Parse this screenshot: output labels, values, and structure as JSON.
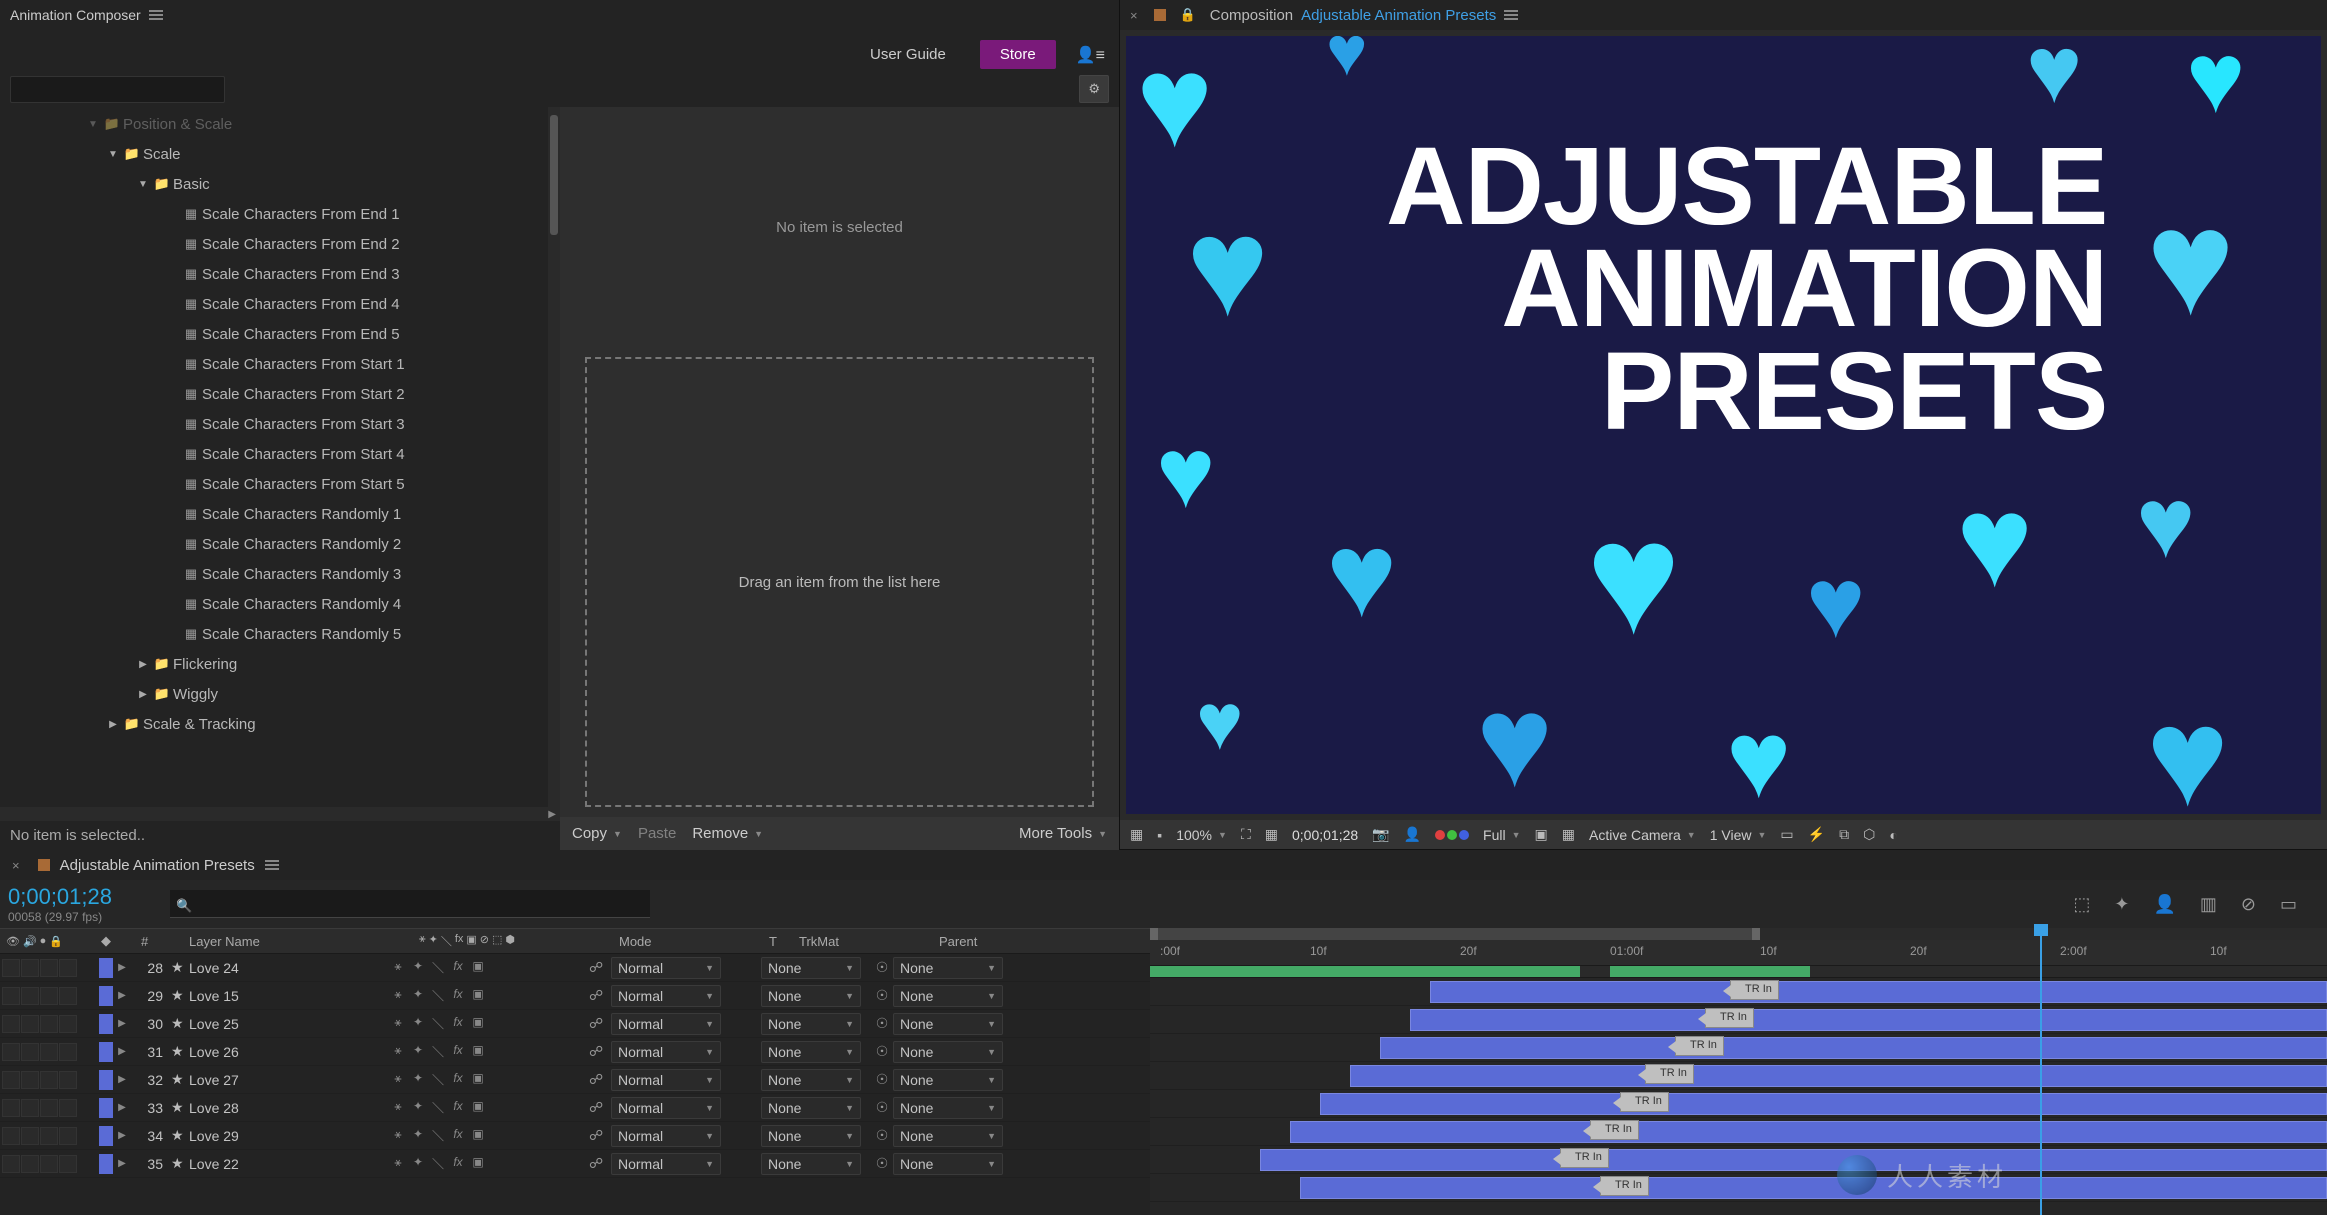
{
  "panel": {
    "title": "Animation Composer",
    "user_guide": "User Guide",
    "store": "Store",
    "settings_icon": "gear",
    "user_icon": "user"
  },
  "tree": {
    "position_scale": "Position & Scale",
    "scale": "Scale",
    "basic": "Basic",
    "items": [
      "Scale Characters From End 1",
      "Scale Characters From End 2",
      "Scale Characters From End 3",
      "Scale Characters From End 4",
      "Scale Characters From End 5",
      "Scale Characters From Start 1",
      "Scale Characters From Start 2",
      "Scale Characters From Start 3",
      "Scale Characters From Start 4",
      "Scale Characters From Start 5",
      "Scale Characters Randomly 1",
      "Scale Characters Randomly 2",
      "Scale Characters Randomly 3",
      "Scale Characters Randomly 4",
      "Scale Characters Randomly 5"
    ],
    "flickering": "Flickering",
    "wiggly": "Wiggly",
    "scale_tracking": "Scale & Tracking"
  },
  "status": "No item is selected..",
  "preview": {
    "empty": "No item is selected",
    "drag": "Drag an item from the list here",
    "copy": "Copy",
    "paste": "Paste",
    "remove": "Remove",
    "more": "More Tools"
  },
  "comp": {
    "label": "Composition",
    "name": "Adjustable Animation Presets",
    "text1": "ADJUSTABLE",
    "text2": "ANIMATION",
    "text3": "PRESETS"
  },
  "viewer_toolbar": {
    "zoom": "100%",
    "timecode": "0;00;01;28",
    "resolution": "Full",
    "camera": "Active Camera",
    "views": "1 View"
  },
  "timeline": {
    "name": "Adjustable Animation Presets",
    "timecode": "0;00;01;28",
    "frame_info": "00058 (29.97 fps)",
    "cols": {
      "num": "#",
      "name": "Layer Name",
      "mode": "Mode",
      "t": "T",
      "trk": "TrkMat",
      "par": "Parent"
    },
    "ruler": [
      ":00f",
      "10f",
      "20f",
      "01:00f",
      "10f",
      "20f",
      "2:00f",
      "10f"
    ],
    "layers": [
      {
        "num": "28",
        "name": "Love 24",
        "mode": "Normal",
        "trk": "None",
        "par": "None",
        "start": 280,
        "marker": 580,
        "mlabel": "TR In"
      },
      {
        "num": "29",
        "name": "Love 15",
        "mode": "Normal",
        "trk": "None",
        "par": "None",
        "start": 260,
        "marker": 555,
        "mlabel": "TR In"
      },
      {
        "num": "30",
        "name": "Love 25",
        "mode": "Normal",
        "trk": "None",
        "par": "None",
        "start": 230,
        "marker": 525,
        "mlabel": "TR In"
      },
      {
        "num": "31",
        "name": "Love 26",
        "mode": "Normal",
        "trk": "None",
        "par": "None",
        "start": 200,
        "marker": 495,
        "mlabel": "TR In"
      },
      {
        "num": "32",
        "name": "Love 27",
        "mode": "Normal",
        "trk": "None",
        "par": "None",
        "start": 170,
        "marker": 470,
        "mlabel": "TR In"
      },
      {
        "num": "33",
        "name": "Love 28",
        "mode": "Normal",
        "trk": "None",
        "par": "None",
        "start": 140,
        "marker": 440,
        "mlabel": "TR In"
      },
      {
        "num": "34",
        "name": "Love 29",
        "mode": "Normal",
        "trk": "None",
        "par": "None",
        "start": 110,
        "marker": 410,
        "mlabel": "TR In"
      },
      {
        "num": "35",
        "name": "Love 22",
        "mode": "Normal",
        "trk": "None",
        "par": "None",
        "start": 150,
        "marker": 450,
        "mlabel": "TR In"
      }
    ]
  },
  "watermark": "人人素材"
}
